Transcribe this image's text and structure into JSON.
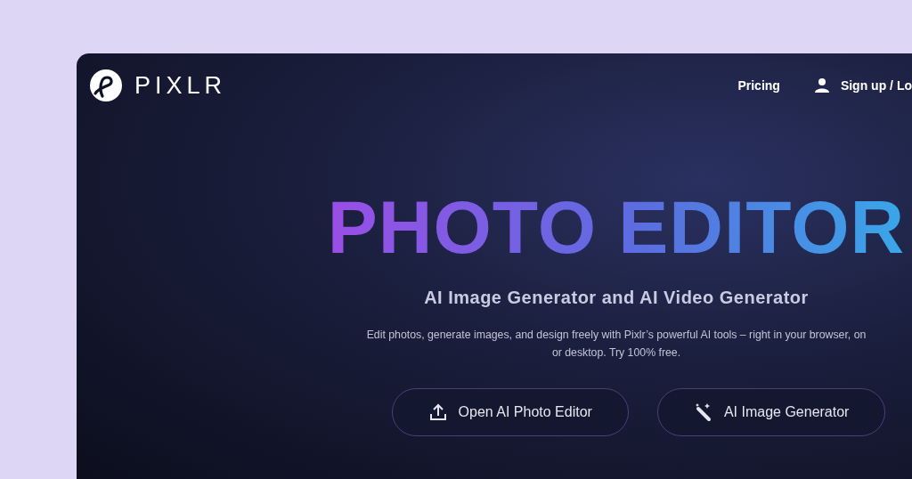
{
  "header": {
    "logo": "PIXLR",
    "nav": [
      {
        "label": "Pricing",
        "kind": "link"
      },
      {
        "label": "Sign up / Lo",
        "kind": "account"
      }
    ]
  },
  "hero": {
    "title": "PHOTO EDITOR",
    "subtitle": "AI Image Generator and AI Video Generator",
    "description_lines": [
      "Edit photos, generate images, and design freely with Pixlr’s powerful AI tools – right in your browser, on",
      "or desktop. Try 100% free."
    ],
    "buttons": [
      {
        "label": "Open AI Photo Editor",
        "kind": "upload"
      },
      {
        "label": "AI Image Generator",
        "kind": "wand"
      }
    ]
  }
}
